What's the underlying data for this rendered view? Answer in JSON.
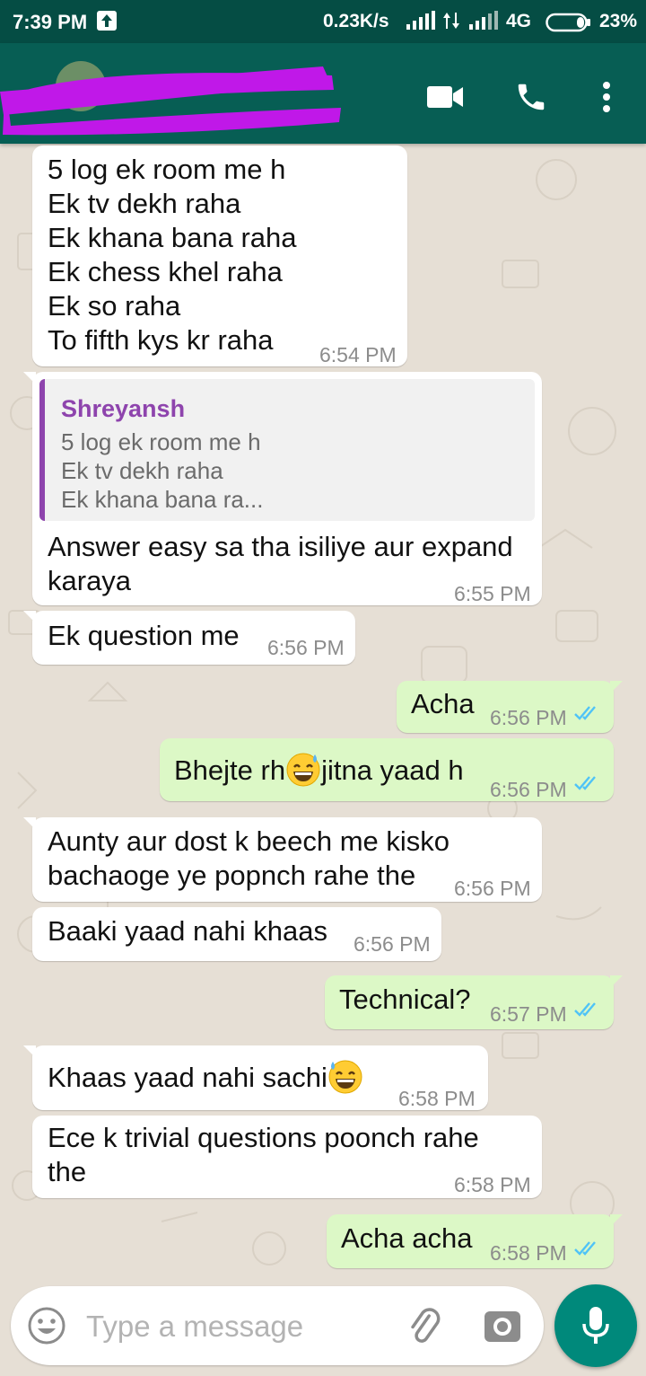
{
  "status_bar": {
    "time": "7:39 PM",
    "speed": "0.23K/s",
    "network": "4G",
    "battery": "23%"
  },
  "header": {
    "contact_name": "",
    "icons": [
      "video-call-icon",
      "phone-icon",
      "more-vert-icon"
    ]
  },
  "messages": [
    {
      "dir": "in",
      "text": "5 log ek room me h\nEk tv dekh raha\nEk khana bana raha\nEk chess khel raha\nEk so raha\nTo fifth kys kr raha",
      "time": "6:54 PM"
    },
    {
      "dir": "in",
      "quote_name": "Shreyansh",
      "quote_text": "5 log ek room me h\nEk tv dekh raha\nEk khana bana ra...",
      "text": "Answer easy sa tha isiliye aur expand\nkaraya",
      "time": "6:55 PM"
    },
    {
      "dir": "in",
      "text": "Ek question me",
      "time": "6:56 PM"
    },
    {
      "dir": "out",
      "text": "Acha",
      "time": "6:56 PM"
    },
    {
      "dir": "out",
      "text_before": "Bhejte rh",
      "text_after": "jitna yaad h",
      "emoji": "grinning-sweat-emoji",
      "time": "6:56 PM"
    },
    {
      "dir": "in",
      "text": "Aunty aur dost k beech me kisko\nbachaoge ye popnch rahe the",
      "time": "6:56 PM"
    },
    {
      "dir": "in",
      "text": "Baaki yaad nahi khaas",
      "time": "6:56 PM"
    },
    {
      "dir": "out",
      "text": "Technical?",
      "time": "6:57 PM"
    },
    {
      "dir": "in",
      "text": "Khaas yaad nahi sachi",
      "emoji": "grinning-sweat-emoji",
      "time": "6:58 PM"
    },
    {
      "dir": "in",
      "text": "Ece k trivial questions poonch rahe\nthe",
      "time": "6:58 PM"
    },
    {
      "dir": "out",
      "text": "Acha acha",
      "time": "6:58 PM"
    }
  ],
  "input": {
    "placeholder": "Type a message"
  },
  "colors": {
    "header": "#075e54",
    "status_bar": "#054d44",
    "outgoing_bubble": "#dcf8c6",
    "incoming_bubble": "#ffffff",
    "quote_accent": "#8e44ad",
    "read_ticks": "#4fc3f7",
    "mic_button": "#00897b"
  }
}
